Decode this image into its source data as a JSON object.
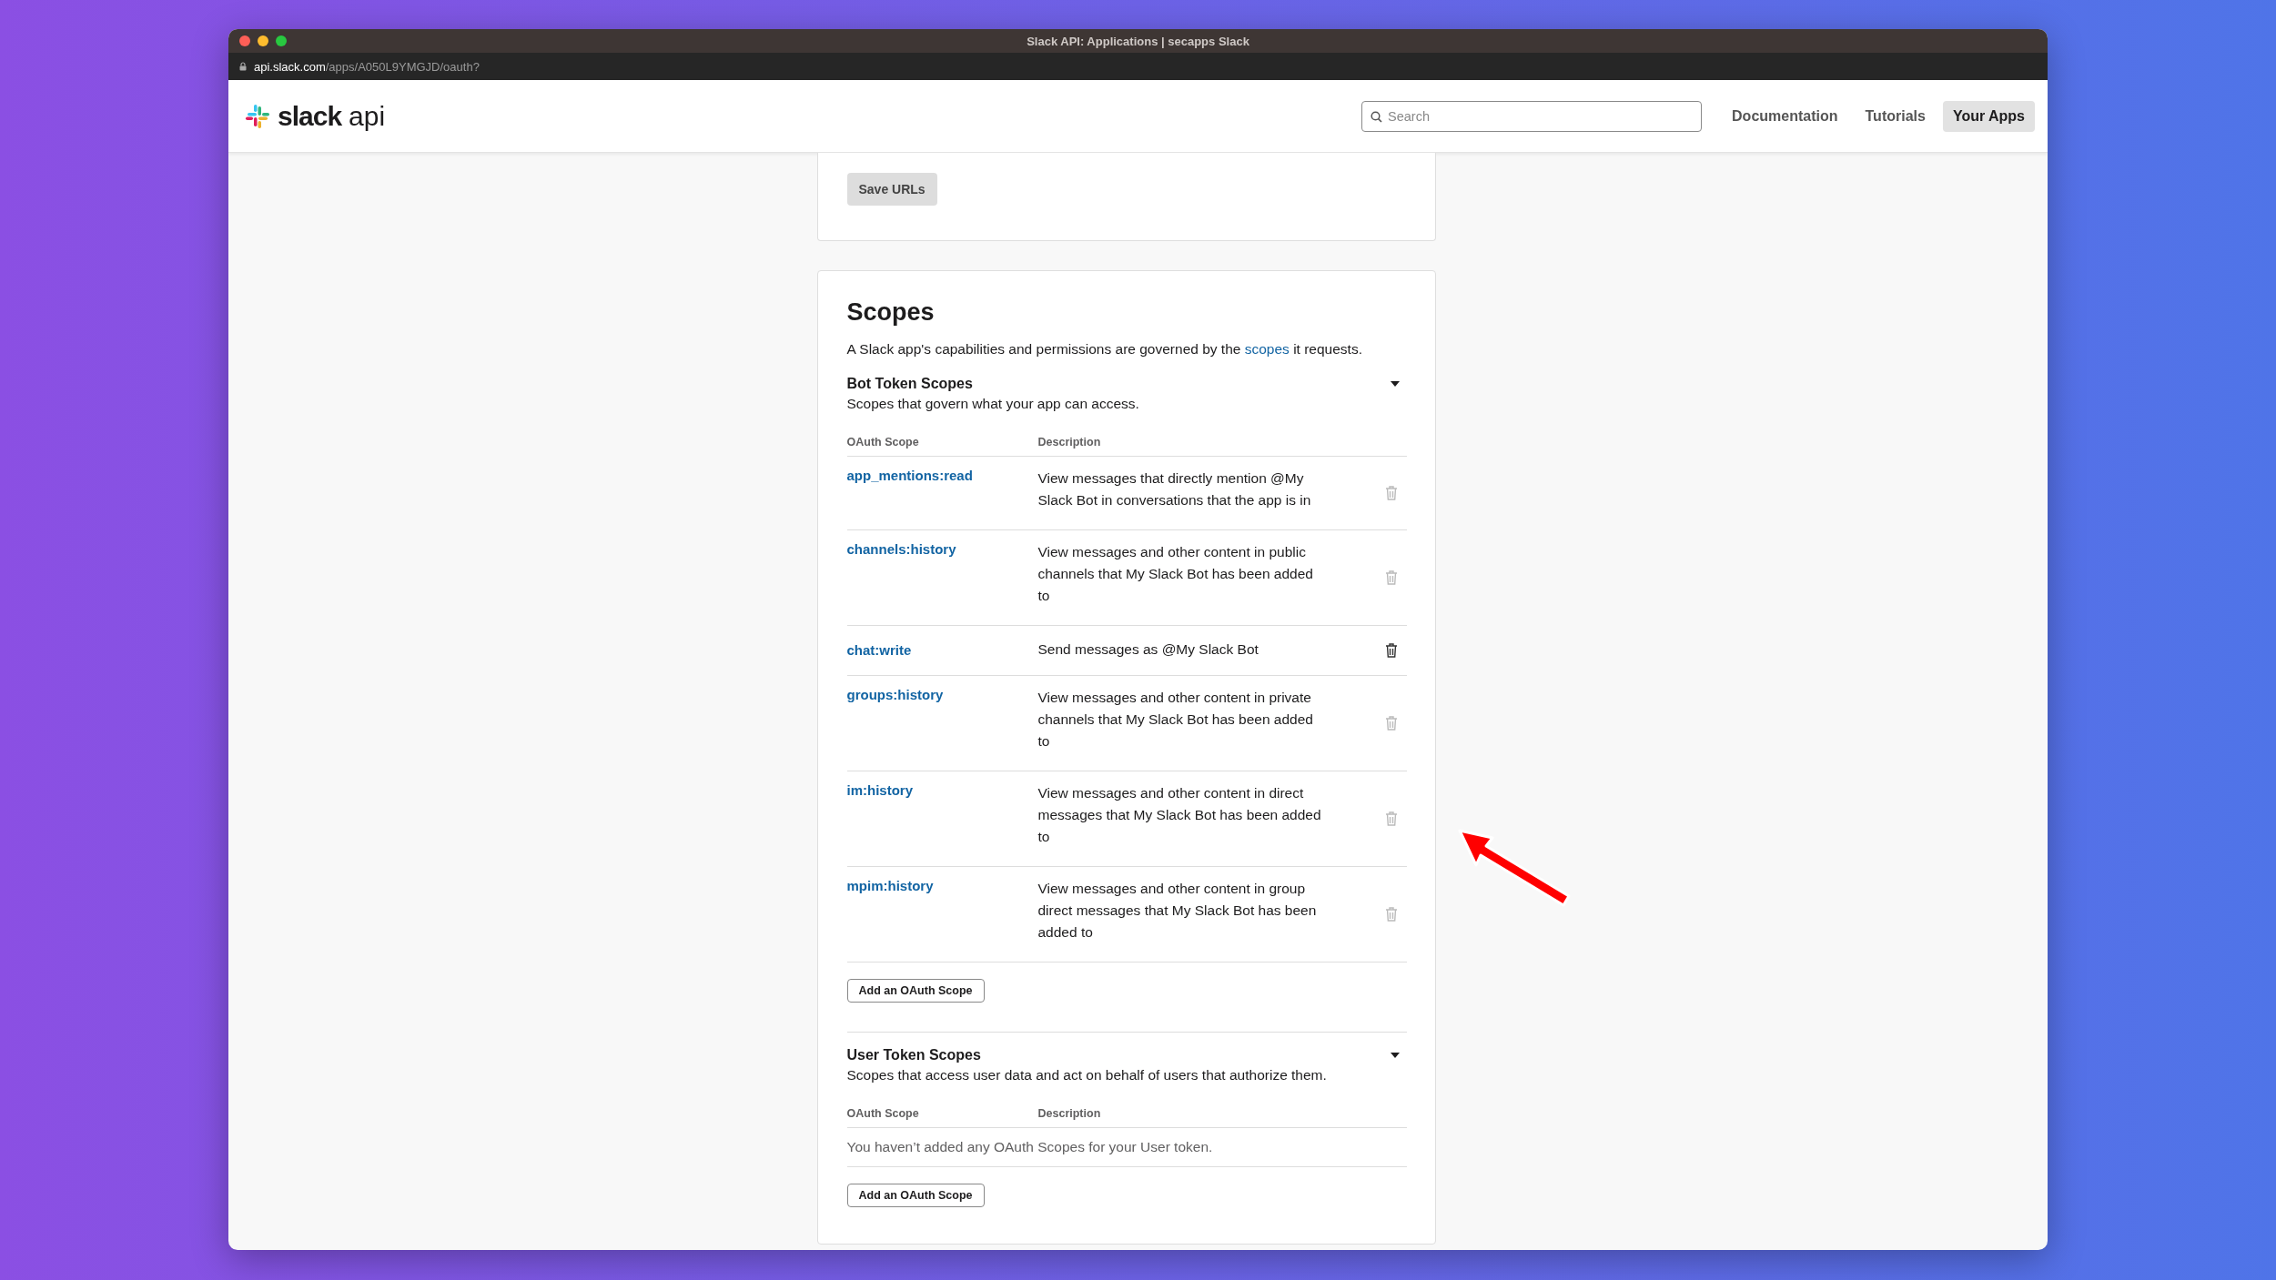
{
  "window": {
    "title": "Slack API: Applications | secapps Slack",
    "url_host": "api.slack.com",
    "url_path": "/apps/A050L9YMGJD/oauth?"
  },
  "header": {
    "logo_word": "slack",
    "logo_suffix": "api",
    "search": {
      "placeholder": "Search"
    },
    "nav": [
      {
        "label": "Documentation",
        "selected": false
      },
      {
        "label": "Tutorials",
        "selected": false
      },
      {
        "label": "Your Apps",
        "selected": true
      }
    ]
  },
  "save_button": "Save URLs",
  "scopes": {
    "title": "Scopes",
    "intro": {
      "before": "A Slack app's capabilities and permissions are governed by the ",
      "link": "scopes",
      "after": " it requests."
    },
    "bot": {
      "title": "Bot Token Scopes",
      "subtitle": "Scopes that govern what your app can access.",
      "expanded": true,
      "columns": [
        "OAuth Scope",
        "Description"
      ],
      "rows": [
        {
          "scope": "app_mentions:read",
          "description": "View messages that directly mention @My Slack Bot in conversations that the app is in",
          "highlighted": false
        },
        {
          "scope": "channels:history",
          "description": "View messages and other content in public channels that My Slack Bot has been added to",
          "highlighted": false
        },
        {
          "scope": "chat:write",
          "description": "Send messages as @My Slack Bot",
          "highlighted": true
        },
        {
          "scope": "groups:history",
          "description": "View messages and other content in private channels that My Slack Bot has been added to",
          "highlighted": false
        },
        {
          "scope": "im:history",
          "description": "View messages and other content in direct messages that My Slack Bot has been added to",
          "highlighted": false
        },
        {
          "scope": "mpim:history",
          "description": "View messages and other content in group direct messages that My Slack Bot has been added to",
          "highlighted": false
        }
      ],
      "add_button": "Add an OAuth Scope"
    },
    "user": {
      "title": "User Token Scopes",
      "subtitle": "Scopes that access user data and act on behalf of users that authorize them.",
      "expanded": true,
      "columns": [
        "OAuth Scope",
        "Description"
      ],
      "empty_text": "You haven’t added any OAuth Scopes for your User token.",
      "add_button": "Add an OAuth Scope"
    }
  }
}
